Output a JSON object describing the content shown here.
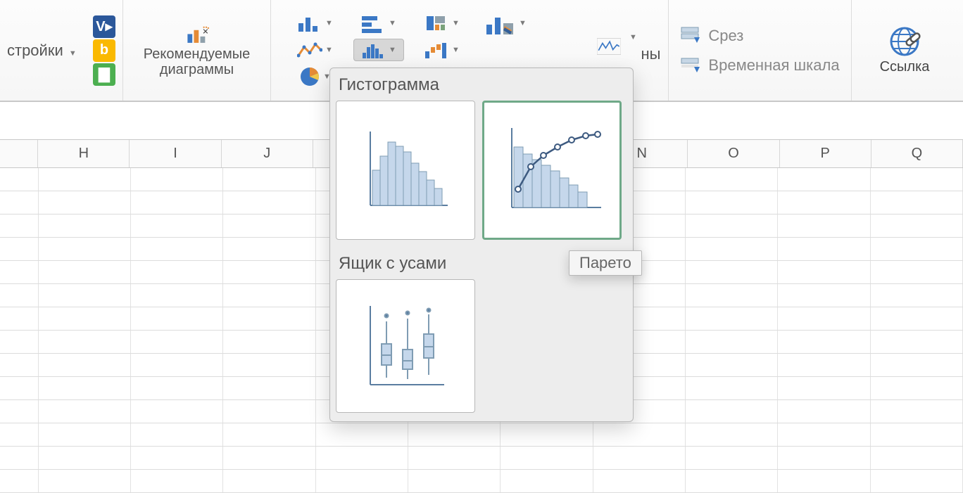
{
  "ribbon": {
    "addins_label": "стройки",
    "recommended_label_top": "Рекомендуемые",
    "recommended_label_bottom": "диаграммы",
    "sparkline_tail": "ны",
    "slicer_label": "Срез",
    "timeline_label": "Временная шкала",
    "link_label": "Ссылка"
  },
  "dropdown": {
    "section1_title": "Гистограмма",
    "section2_title": "Ящик с усами",
    "tooltip": "Парето"
  },
  "columns": [
    "",
    "H",
    "I",
    "J",
    "",
    "",
    "",
    "N",
    "O",
    "P",
    "Q"
  ]
}
